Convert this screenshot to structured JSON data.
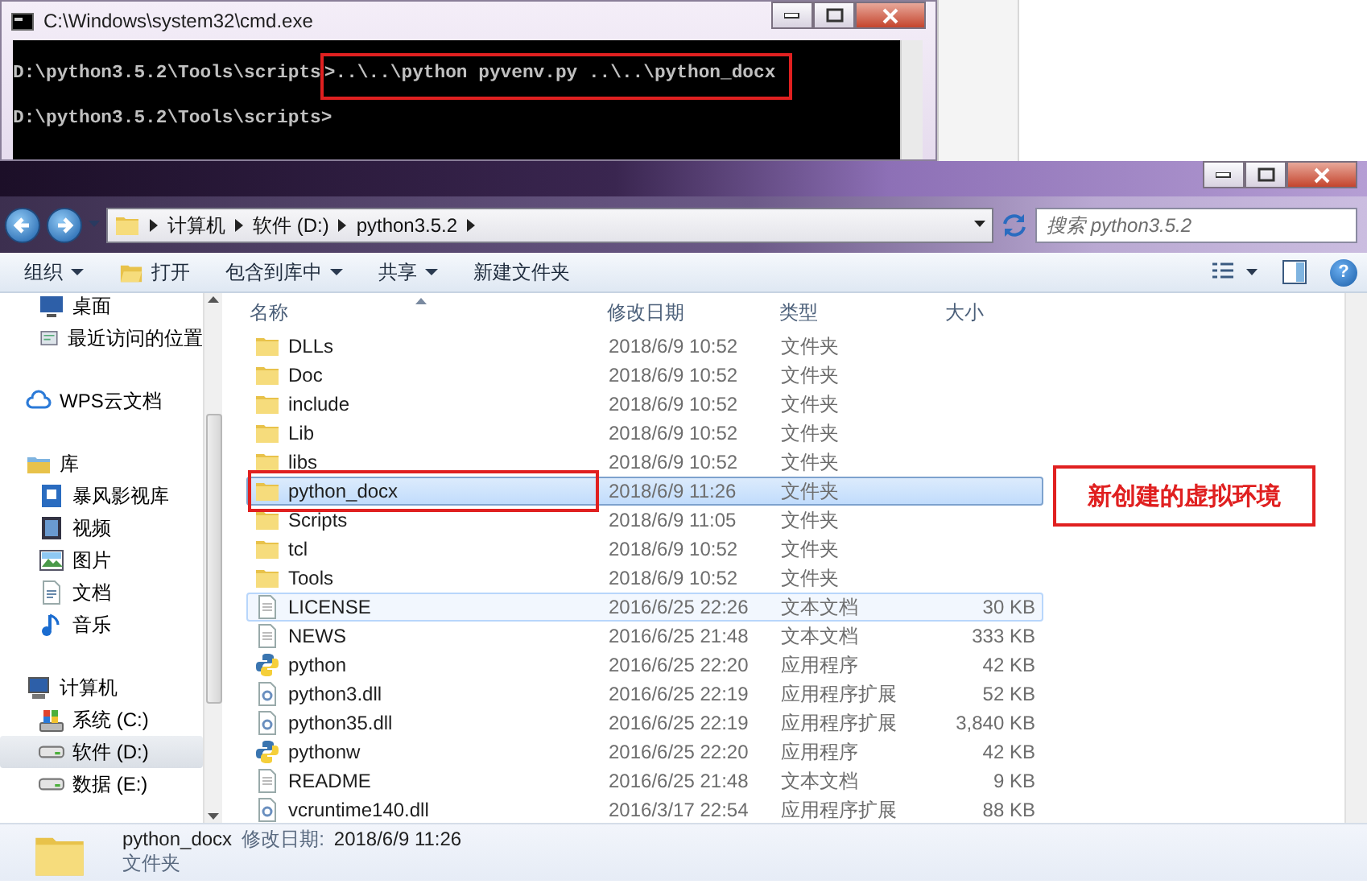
{
  "cmd_window": {
    "title": "C:\\Windows\\system32\\cmd.exe",
    "lines": [
      {
        "text": "D:\\python3.5.2\\Tools\\scripts",
        "outlined_text": ">..\\..\\python pyvenv.py ..\\..\\python_docx"
      },
      {
        "text": "D:\\python3.5.2\\Tools\\scripts>"
      }
    ]
  },
  "explorer": {
    "breadcrumb": [
      "计算机",
      "软件 (D:)",
      "python3.5.2"
    ],
    "search": {
      "placeholder": "搜索 python3.5.2"
    },
    "toolbar": [
      {
        "label": "组织",
        "dropdown": true
      },
      {
        "label": "打开",
        "kind": "open"
      },
      {
        "label": "包含到库中",
        "dropdown": true
      },
      {
        "label": "共享",
        "dropdown": true
      },
      {
        "label": "新建文件夹"
      }
    ],
    "help_label": "?",
    "sidebar": {
      "items": [
        {
          "children": [
            {
              "label": "桌面",
              "kind": "desktop",
              "selected": false
            },
            {
              "label": "最近访问的位置",
              "kind": "recent",
              "selected": false
            }
          ]
        },
        {
          "label": "WPS云文档",
          "kind": "cloud",
          "selected": false
        },
        {
          "label": "库",
          "kind": "library",
          "selected": false,
          "children": [
            {
              "label": "暴风影视库",
              "kind": "media",
              "selected": false
            },
            {
              "label": "视频",
              "kind": "video",
              "selected": false
            },
            {
              "label": "图片",
              "kind": "picture",
              "selected": false
            },
            {
              "label": "文档",
              "kind": "document",
              "selected": false
            },
            {
              "label": "音乐",
              "kind": "music",
              "selected": false
            }
          ]
        },
        {
          "label": "计算机",
          "kind": "computer",
          "selected": false,
          "children": [
            {
              "label": "系统 (C:)",
              "kind": "system_drive",
              "selected": false
            },
            {
              "label": "软件 (D:)",
              "kind": "drive",
              "selected": true
            },
            {
              "label": "数据 (E:)",
              "kind": "drive",
              "selected": false
            }
          ]
        }
      ]
    },
    "columns": [
      "名称",
      "修改日期",
      "类型",
      "大小"
    ],
    "rows": [
      {
        "name": "DLLs",
        "date": "2018/6/9 10:52",
        "type": "文件夹",
        "size": "",
        "kind": "folder",
        "selected": false,
        "hovered": false,
        "outlined": false
      },
      {
        "name": "Doc",
        "date": "2018/6/9 10:52",
        "type": "文件夹",
        "size": "",
        "kind": "folder",
        "selected": false,
        "hovered": false,
        "outlined": false
      },
      {
        "name": "include",
        "date": "2018/6/9 10:52",
        "type": "文件夹",
        "size": "",
        "kind": "folder",
        "selected": false,
        "hovered": false,
        "outlined": false
      },
      {
        "name": "Lib",
        "date": "2018/6/9 10:52",
        "type": "文件夹",
        "size": "",
        "kind": "folder",
        "selected": false,
        "hovered": false,
        "outlined": false
      },
      {
        "name": "libs",
        "date": "2018/6/9 10:52",
        "type": "文件夹",
        "size": "",
        "kind": "folder",
        "selected": false,
        "hovered": false,
        "outlined": false
      },
      {
        "name": "python_docx",
        "date": "2018/6/9 11:26",
        "type": "文件夹",
        "size": "",
        "kind": "folder",
        "selected": true,
        "hovered": false,
        "outlined": true
      },
      {
        "name": "Scripts",
        "date": "2018/6/9 11:05",
        "type": "文件夹",
        "size": "",
        "kind": "folder",
        "selected": false,
        "hovered": false,
        "outlined": false
      },
      {
        "name": "tcl",
        "date": "2018/6/9 10:52",
        "type": "文件夹",
        "size": "",
        "kind": "folder",
        "selected": false,
        "hovered": false,
        "outlined": false
      },
      {
        "name": "Tools",
        "date": "2018/6/9 10:52",
        "type": "文件夹",
        "size": "",
        "kind": "folder",
        "selected": false,
        "hovered": false,
        "outlined": false
      },
      {
        "name": "LICENSE",
        "date": "2016/6/25 22:26",
        "type": "文本文档",
        "size": "30 KB",
        "kind": "text",
        "selected": false,
        "hovered": true,
        "outlined": false
      },
      {
        "name": "NEWS",
        "date": "2016/6/25 21:48",
        "type": "文本文档",
        "size": "333 KB",
        "kind": "text",
        "selected": false,
        "hovered": false,
        "outlined": false
      },
      {
        "name": "python",
        "date": "2016/6/25 22:20",
        "type": "应用程序",
        "size": "42 KB",
        "kind": "python",
        "selected": false,
        "hovered": false,
        "outlined": false
      },
      {
        "name": "python3.dll",
        "date": "2016/6/25 22:19",
        "type": "应用程序扩展",
        "size": "52 KB",
        "kind": "dll",
        "selected": false,
        "hovered": false,
        "outlined": false
      },
      {
        "name": "python35.dll",
        "date": "2016/6/25 22:19",
        "type": "应用程序扩展",
        "size": "3,840 KB",
        "kind": "dll",
        "selected": false,
        "hovered": false,
        "outlined": false
      },
      {
        "name": "pythonw",
        "date": "2016/6/25 22:20",
        "type": "应用程序",
        "size": "42 KB",
        "kind": "python",
        "selected": false,
        "hovered": false,
        "outlined": false
      },
      {
        "name": "README",
        "date": "2016/6/25 21:48",
        "type": "文本文档",
        "size": "9 KB",
        "kind": "text",
        "selected": false,
        "hovered": false,
        "outlined": false
      },
      {
        "name": "vcruntime140.dll",
        "date": "2016/3/17 22:54",
        "type": "应用程序扩展",
        "size": "88 KB",
        "kind": "dll",
        "selected": false,
        "hovered": false,
        "outlined": false
      }
    ],
    "annotation": "新创建的虚拟环境",
    "details": {
      "name": "python_docx",
      "date_label": "修改日期:",
      "date": "2018/6/9 11:26",
      "type": "文件夹"
    }
  }
}
